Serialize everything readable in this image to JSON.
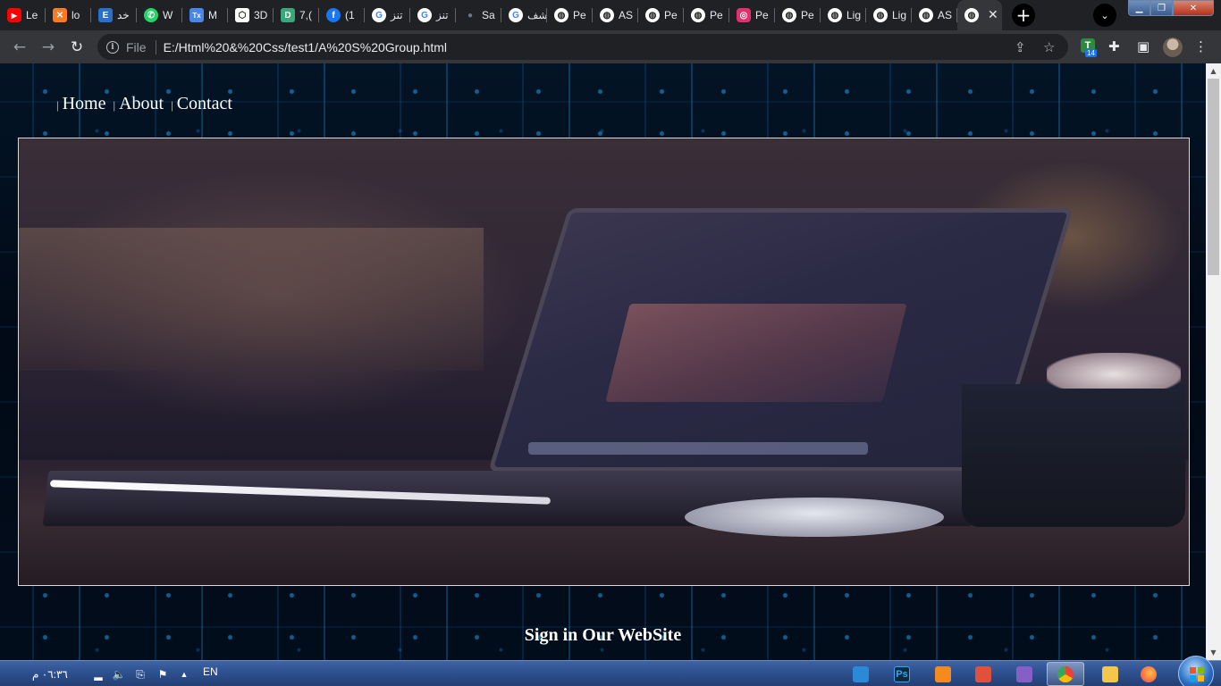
{
  "browser": {
    "tabs": [
      {
        "label": "Le",
        "icon": "youtube-icon",
        "color": "#ff0000"
      },
      {
        "label": "lo",
        "icon": "xampp-icon",
        "color": "#fb7a24"
      },
      {
        "label": "خد",
        "icon": "e-icon",
        "color": "#2a6fc9"
      },
      {
        "label": "W",
        "icon": "whatsapp-icon",
        "color": "#25d366"
      },
      {
        "label": "M",
        "icon": "tx-icon",
        "color": "#4a86e8"
      },
      {
        "label": "3D",
        "icon": "codepen-icon",
        "color": "#ffffff"
      },
      {
        "label": "7,(",
        "icon": "d-icon",
        "color": "#3aa77a"
      },
      {
        "label": "(1",
        "icon": "facebook-icon",
        "color": "#1877f2"
      },
      {
        "label": "تنز",
        "icon": "google-icon",
        "color": "#ffffff"
      },
      {
        "label": "تنز",
        "icon": "google-icon",
        "color": "#ffffff"
      },
      {
        "label": "Sa",
        "icon": "github-icon",
        "color": "#6e7681"
      },
      {
        "label": "شف",
        "icon": "google-icon",
        "color": "#ffffff"
      },
      {
        "label": "Pe",
        "icon": "globe-icon",
        "color": "#ffffff"
      },
      {
        "label": "AS",
        "icon": "globe-icon",
        "color": "#ffffff"
      },
      {
        "label": "Pe",
        "icon": "globe-icon",
        "color": "#ffffff"
      },
      {
        "label": "Pe",
        "icon": "globe-icon",
        "color": "#ffffff"
      },
      {
        "label": "Pe",
        "icon": "instagram-icon",
        "color": "#e1306c"
      },
      {
        "label": "Pe",
        "icon": "globe-icon",
        "color": "#ffffff"
      },
      {
        "label": "Lig",
        "icon": "globe-icon",
        "color": "#ffffff"
      },
      {
        "label": "Lig",
        "icon": "globe-icon",
        "color": "#ffffff"
      },
      {
        "label": "AS",
        "icon": "globe-icon",
        "color": "#ffffff"
      }
    ],
    "active_tab_close": "✕",
    "new_tab": "+",
    "file_label": "File",
    "url": "E:/Html%20&%20Css/test1/A%20S%20Group.html",
    "extension_badge": "14",
    "extension_letter": "T"
  },
  "page": {
    "nav": [
      {
        "label": "Home"
      },
      {
        "label": "About"
      },
      {
        "label": "Contact"
      }
    ],
    "nav_separator": "|",
    "signin_title": "Sign in Our WebSite"
  },
  "taskbar": {
    "clock": "٠٦:٣٦ م",
    "language": "EN",
    "apps": [
      {
        "name": "vscode-icon",
        "color": "#2b8ad8",
        "active": false
      },
      {
        "name": "photoshop-icon",
        "label": "Ps",
        "color": "#0b2a3c",
        "active": false
      },
      {
        "name": "sublime-icon",
        "color": "#f58b1f",
        "active": false
      },
      {
        "name": "brackets-icon",
        "color": "#e0503a",
        "active": false
      },
      {
        "name": "visual-studio-icon",
        "color": "#865fc5",
        "active": false
      },
      {
        "name": "chrome-icon",
        "color": "#ea4335",
        "active": true
      },
      {
        "name": "explorer-icon",
        "color": "#f3c74b",
        "active": false
      },
      {
        "name": "firefox-icon",
        "color": "#ff7139",
        "active": false
      }
    ]
  }
}
